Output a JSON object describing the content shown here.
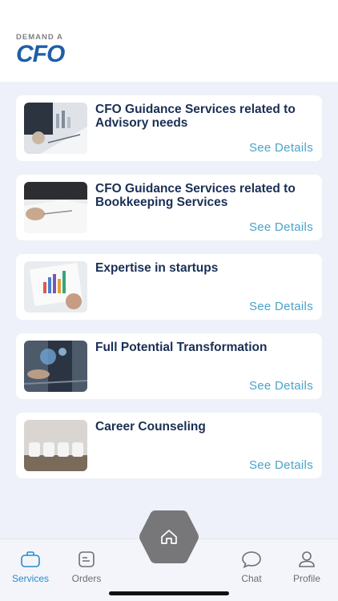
{
  "header": {
    "logo_top": "DEMAND A",
    "logo_main": "CFO"
  },
  "services": [
    {
      "title": "CFO Guidance Services related to Advisory needs",
      "link": "See Details"
    },
    {
      "title": "CFO Guidance Services related to Bookkeeping Services",
      "link": "See Details"
    },
    {
      "title": "Expertise in startups",
      "link": "See Details"
    },
    {
      "title": "Full Potential Transformation",
      "link": "See Details"
    },
    {
      "title": "Career Counseling",
      "link": "See Details"
    }
  ],
  "tabs": [
    {
      "label": "Services",
      "icon": "briefcase-icon",
      "active": true
    },
    {
      "label": "Orders",
      "icon": "document-icon",
      "active": false
    },
    {
      "label": "Chat",
      "icon": "chat-bubble-icon",
      "active": false
    },
    {
      "label": "Profile",
      "icon": "person-icon",
      "active": false
    }
  ],
  "home_icon": "home-icon",
  "colors": {
    "accent": "#2a8bc9",
    "link": "#4aa3c9",
    "title": "#1a2f55",
    "background": "#eef1f9",
    "home_button": "#77777a"
  }
}
